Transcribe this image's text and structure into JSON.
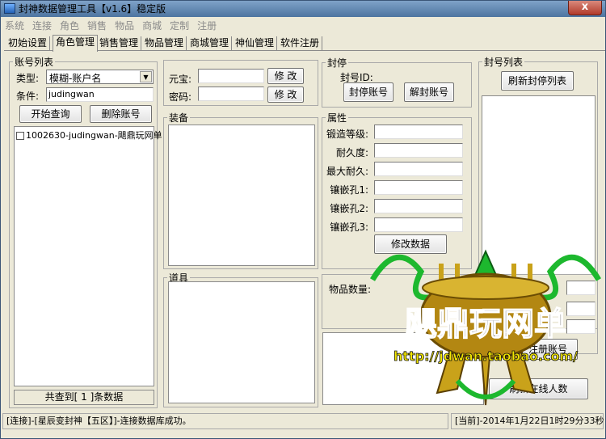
{
  "window": {
    "title": "封神数据管理工具【v1.6】稳定版",
    "close": "x"
  },
  "menu": [
    "系统",
    "连接",
    "角色",
    "销售",
    "物品",
    "商城",
    "定制",
    "注册"
  ],
  "tabs": [
    "初始设置",
    "角色管理",
    "销售管理",
    "物品管理",
    "商城管理",
    "神仙管理",
    "软件注册"
  ],
  "account_panel": {
    "title": "账号列表",
    "type_label": "类型:",
    "type_value": "模糊-账户名",
    "cond_label": "条件:",
    "cond_value": "judingwan",
    "query_btn": "开始查询",
    "delete_btn": "删除账号",
    "items": [
      "1002630-judingwan-飓鼎玩网单"
    ],
    "footer": "共查到[ 1 ]条数据"
  },
  "currency": {
    "yuanbao_label": "元宝:",
    "yuanbao_value": "",
    "password_label": "密码:",
    "password_value": "",
    "modify1": "修 改",
    "modify2": "修 改"
  },
  "ban_panel": {
    "title": "封停",
    "id_label": "封号ID:",
    "ban_btn": "封停账号",
    "unban_btn": "解封账号"
  },
  "ban_list": {
    "title": "封号列表",
    "refresh_btn": "刷新封停列表"
  },
  "equip": {
    "title": "装备"
  },
  "props": {
    "title": "道具"
  },
  "attributes": {
    "title": "属性",
    "rows": [
      {
        "label": "锻造等级:",
        "value": ""
      },
      {
        "label": "耐久度:",
        "value": ""
      },
      {
        "label": "最大耐久:",
        "value": ""
      },
      {
        "label": "镶嵌孔1:",
        "value": ""
      },
      {
        "label": "镶嵌孔2:",
        "value": ""
      },
      {
        "label": "镶嵌孔3:",
        "value": ""
      }
    ],
    "modify_btn": "修改数据"
  },
  "item_count": {
    "label": "物品数量:"
  },
  "register_btn": "注册账号",
  "online_btn": "刷新在线人数",
  "watermark": {
    "name": "飓鼎玩网单",
    "url": "http://jdwan.taobao.com/",
    "colors": {
      "gold": "#c9a21a",
      "green": "#1db82e",
      "url": "#f2e600"
    }
  },
  "status": {
    "left": "[连接]-[星辰变封神【五区】]-连接数据库成功。",
    "right": "[当前]-2014年1月22日1时29分33秒"
  }
}
